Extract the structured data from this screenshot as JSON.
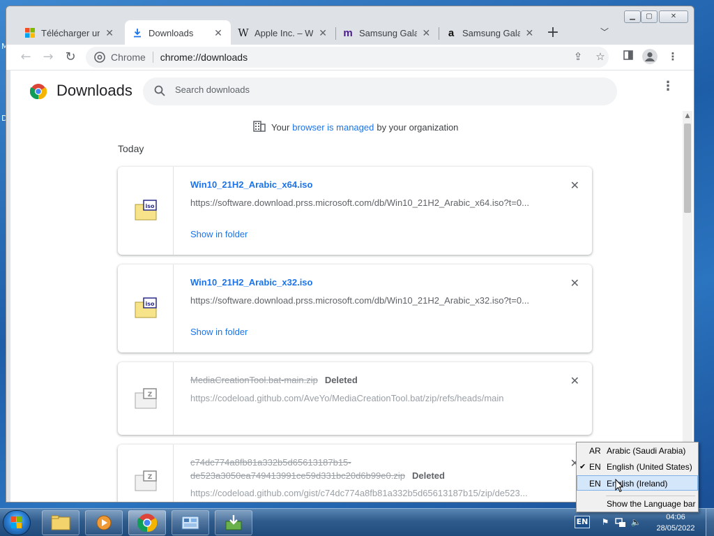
{
  "desktop": {
    "fragment_top": "M",
    "fragment_mid": "D"
  },
  "browser": {
    "tabs": [
      {
        "label": "Télécharger une",
        "icon": "microsoft-logo-icon",
        "active": false
      },
      {
        "label": "Downloads",
        "icon": "download-icon",
        "active": true
      },
      {
        "label": "Apple Inc. – Wik",
        "icon": "wikipedia-icon",
        "active": false
      },
      {
        "label": "Samsung Galaxy",
        "icon": "m-logo-icon",
        "active": false
      },
      {
        "label": "Samsung Galaxy",
        "icon": "amazon-icon",
        "active": false
      }
    ],
    "omnibox": {
      "site": "Chrome",
      "url": "chrome://downloads"
    }
  },
  "downloads": {
    "title": "Downloads",
    "search_placeholder": "Search downloads",
    "managed_prefix": "Your",
    "managed_link": "browser is managed",
    "managed_suffix": "by your organization",
    "section": "Today",
    "items": [
      {
        "name": "Win10_21H2_Arabic_x64.iso",
        "url": "https://software.download.prss.microsoft.com/db/Win10_21H2_Arabic_x64.iso?t=0...",
        "action": "Show in folder",
        "status": ""
      },
      {
        "name": "Win10_21H2_Arabic_x32.iso",
        "url": "https://software.download.prss.microsoft.com/db/Win10_21H2_Arabic_x32.iso?t=0...",
        "action": "Show in folder",
        "status": ""
      },
      {
        "name": "MediaCreationTool.bat-main.zip",
        "url": "https://codeload.github.com/AveYo/MediaCreationTool.bat/zip/refs/heads/main",
        "action": "",
        "status": "Deleted"
      },
      {
        "name": "c74dc774a8fb81a332b5d65613187b15-de523a3050ea749413991ce59d331bc20d6b99e0.zip",
        "url": "https://codeload.github.com/gist/c74dc774a8fb81a332b5d65613187b15/zip/de523...",
        "action": "",
        "status": "Deleted"
      }
    ]
  },
  "language_menu": {
    "items": [
      {
        "code": "AR",
        "name": "Arabic (Saudi Arabia)",
        "checked": false
      },
      {
        "code": "EN",
        "name": "English (United States)",
        "checked": true
      },
      {
        "code": "EN",
        "name": "English (Ireland)",
        "checked": false
      }
    ],
    "show_bar": "Show the Language bar"
  },
  "taskbar": {
    "lang": "EN",
    "time": "04:06",
    "date": "28/05/2022"
  }
}
